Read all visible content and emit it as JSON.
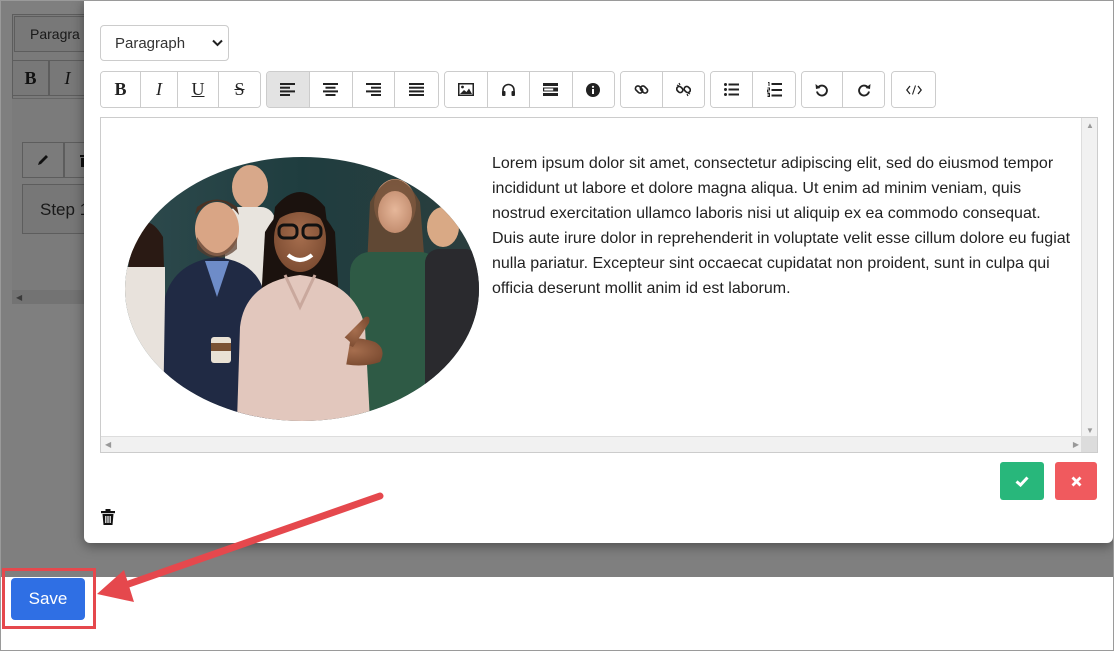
{
  "background": {
    "select_label": "Paragra",
    "toolbar_bold": "B",
    "toolbar_italic": "I",
    "step_text": "Step 1"
  },
  "modal": {
    "format_select": "Paragraph",
    "toolbar": {
      "bold": "B",
      "italic": "I",
      "underline": "U",
      "strikethrough": "S",
      "icons": [
        "bold",
        "italic",
        "underline",
        "strikethrough",
        "align-left",
        "align-center",
        "align-right",
        "align-justify",
        "image-icon",
        "audio-icon",
        "template-icon",
        "info-icon",
        "link-icon",
        "unlink-icon",
        "bullet-list-icon",
        "numbered-list-icon",
        "undo-icon",
        "redo-icon",
        "code-icon"
      ],
      "active": "align-left"
    },
    "content": {
      "paragraph": "Lorem ipsum dolor sit amet, consectetur adipiscing elit, sed do eiusmod tempor incididunt ut labore et dolore magna aliqua. Ut enim ad minim veniam, quis nostrud exercitation ullamco laboris nisi ut aliquip ex ea commodo consequat. Duis aute irure dolor in reprehenderit in voluptate velit esse cillum dolore eu fugiat nulla pariatur. Excepteur sint occaecat cupidatat non proident, sunt in culpa qui officia deserunt mollit anim id est laborum."
    },
    "confirm_icon": "check-icon",
    "cancel_icon": "close-icon",
    "delete_icon": "trash-icon"
  },
  "save_button": {
    "label": "Save"
  },
  "colors": {
    "confirm": "#28b77b",
    "cancel": "#f05a5e",
    "save": "#2f6fe4",
    "highlight": "#e5484d"
  }
}
